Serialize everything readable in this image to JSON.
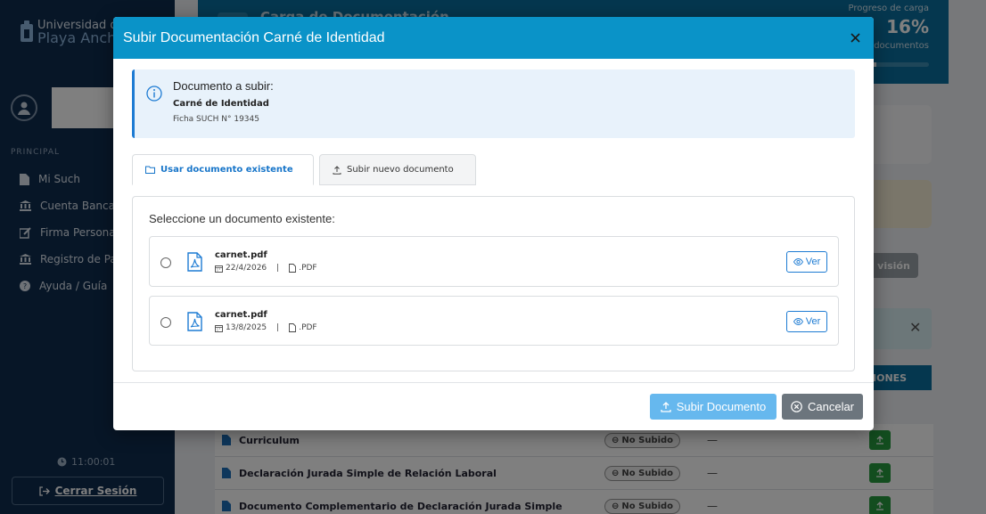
{
  "sidebar": {
    "logo_line1": "Universidad de",
    "logo_line2": "Playa Ancha",
    "section_label": "PRINCIPAL",
    "items": [
      {
        "label": "Mi Such",
        "icon": "file-icon"
      },
      {
        "label": "Cuenta Bancaria",
        "icon": "bank-icon"
      },
      {
        "label": "Firma Personal",
        "icon": "signature-icon"
      },
      {
        "label": "Registro de Pari",
        "icon": "bank-icon"
      },
      {
        "label": "Ayuda / Guía",
        "icon": "help-icon"
      }
    ],
    "clock": "11:00:01",
    "logout_label": "Cerrar Sesión"
  },
  "header": {
    "title": "Carga de Documentación",
    "progress_label": "Progreso de carga",
    "progress_percent": "16%",
    "progress_value": 0.16,
    "progress_docs": "5 documentos"
  },
  "background": {
    "review_button": "visión",
    "table_header": "IONES",
    "rows": [
      {
        "name": "Curriculum",
        "status": "No Subido",
        "date": "—"
      },
      {
        "name": "Declaración Jurada Simple de Relación Laboral",
        "status": "No Subido",
        "date": "—"
      },
      {
        "name": "Documento Complementario de Declaración Jurada Simple",
        "status": "No Subido",
        "date": "—"
      }
    ]
  },
  "modal": {
    "title": "Subir Documentación Carné de Identidad",
    "info": {
      "label": "Documento a subir:",
      "document": "Carné de Identidad",
      "ficha": "Ficha SUCH N° 19345"
    },
    "tabs": [
      {
        "label": "Usar documento existente",
        "active": true
      },
      {
        "label": "Subir nuevo documento",
        "active": false
      }
    ],
    "panel_label": "Seleccione un documento existente:",
    "files": [
      {
        "name": "carnet.pdf",
        "date": "22/4/2026",
        "type": ".PDF",
        "view_label": "Ver"
      },
      {
        "name": "carnet.pdf",
        "date": "13/8/2025",
        "type": ".PDF",
        "view_label": "Ver"
      }
    ],
    "submit_label": "Subir Documento",
    "cancel_label": "Cancelar"
  },
  "colors": {
    "modal_header": "#0a93c8",
    "accent": "#1d7bd3",
    "submit": "#66b8ee",
    "cancel": "#6c757d",
    "sidebar": "#0f2c4f"
  }
}
